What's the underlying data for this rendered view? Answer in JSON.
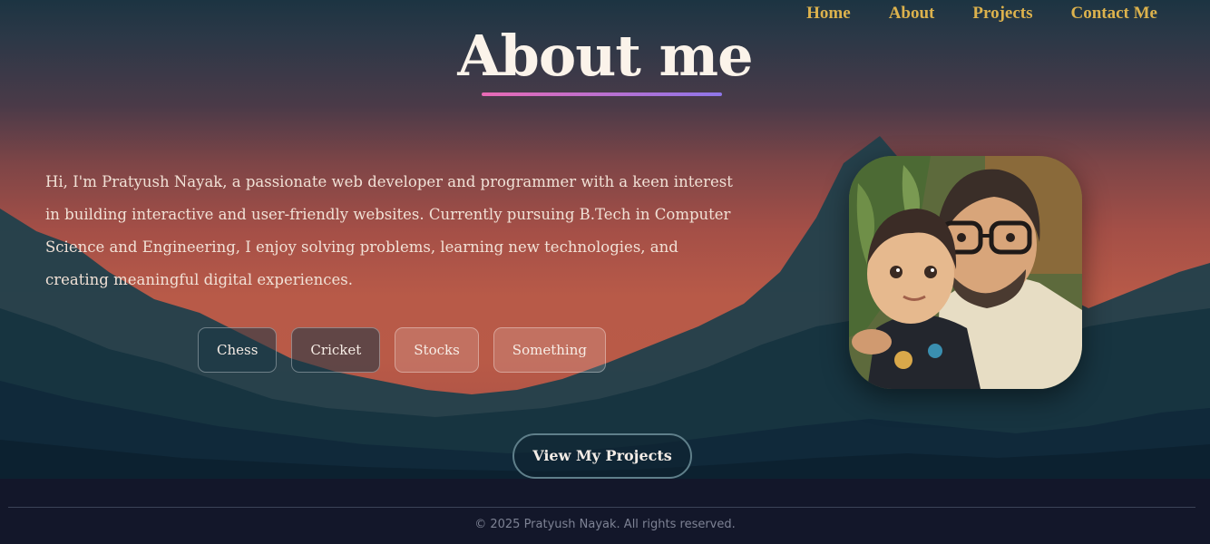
{
  "nav": {
    "items": [
      {
        "label": "Home"
      },
      {
        "label": "About"
      },
      {
        "label": "Projects"
      },
      {
        "label": "Contact Me"
      }
    ]
  },
  "page": {
    "title": "About me",
    "bio": "Hi, I'm Pratyush Nayak, a passionate web developer and programmer with a keen interest in building interactive and user-friendly websites. Currently pursuing B.Tech in Computer Science and Engineering, I enjoy solving problems, learning new technologies, and creating meaningful digital experiences.",
    "interests": [
      {
        "label": "Chess"
      },
      {
        "label": "Cricket"
      },
      {
        "label": "Stocks"
      },
      {
        "label": "Something"
      }
    ],
    "cta_label": "View My Projects"
  },
  "footer": {
    "copyright": "© 2025 Pratyush Nayak. All rights reserved."
  },
  "colors": {
    "nav_link": "#dcb24d",
    "title_underline_start": "#e86ab4",
    "title_underline_end": "#8e76e9",
    "footer_bg": "#13172a"
  }
}
